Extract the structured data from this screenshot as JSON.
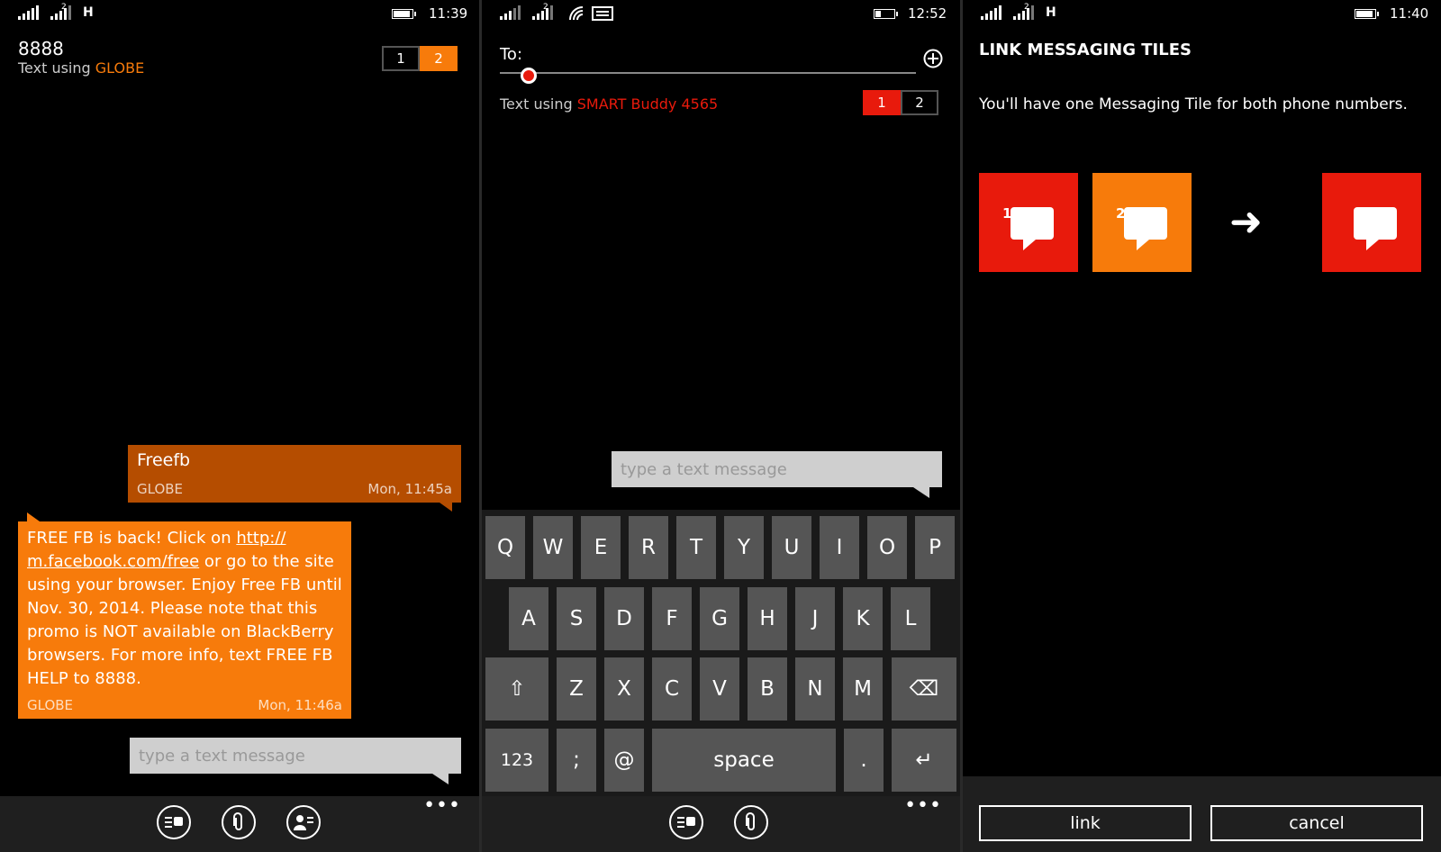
{
  "colors": {
    "orange": "#f77b0b",
    "orange_dark": "#b54d00",
    "red": "#e81a0c",
    "gray_key": "#555555"
  },
  "screen1": {
    "time": "11:39",
    "network": "H",
    "title": "8888",
    "subtitle_prefix": "Text using",
    "subtitle_carrier": "GLOBE",
    "sim1": "1",
    "sim2": "2",
    "sent": {
      "text": "Freefb",
      "carrier": "GLOBE",
      "time": "Mon, 11:45a"
    },
    "received": {
      "text_before": "FREE FB is back! Click on ",
      "link": "http:// m.facebook.com/free",
      "text_after": " or go to the site using your browser. Enjoy Free FB until Nov. 30, 2014. Please note that this promo is NOT available on BlackBerry browsers. For more info, text FREE FB HELP to 8888.",
      "carrier": "GLOBE",
      "time": "Mon, 11:46a"
    },
    "input_placeholder": "type a text message",
    "more": "•••"
  },
  "screen2": {
    "time": "12:52",
    "to_label": "To:",
    "subtitle_prefix": "Text using",
    "subtitle_carrier": "SMART Buddy 4565",
    "sim1": "1",
    "sim2": "2",
    "input_placeholder": "type a text message",
    "keyboard": {
      "row1": [
        "Q",
        "W",
        "E",
        "R",
        "T",
        "Y",
        "U",
        "I",
        "O",
        "P"
      ],
      "row2": [
        "A",
        "S",
        "D",
        "F",
        "G",
        "H",
        "J",
        "K",
        "L"
      ],
      "row3": [
        "Z",
        "X",
        "C",
        "V",
        "B",
        "N",
        "M"
      ],
      "shift": "⇧",
      "backspace": "⌫",
      "numbers": "123",
      "semicolon": ";",
      "at": "@",
      "space": "space",
      "period": ".",
      "enter": "↵"
    },
    "more": "•••"
  },
  "screen3": {
    "time": "11:40",
    "network": "H",
    "title": "LINK MESSAGING TILES",
    "description": "You'll have one Messaging Tile for both phone numbers.",
    "tile1_num": "1",
    "tile2_num": "2",
    "arrow": "➜",
    "link_label": "link",
    "cancel_label": "cancel"
  }
}
